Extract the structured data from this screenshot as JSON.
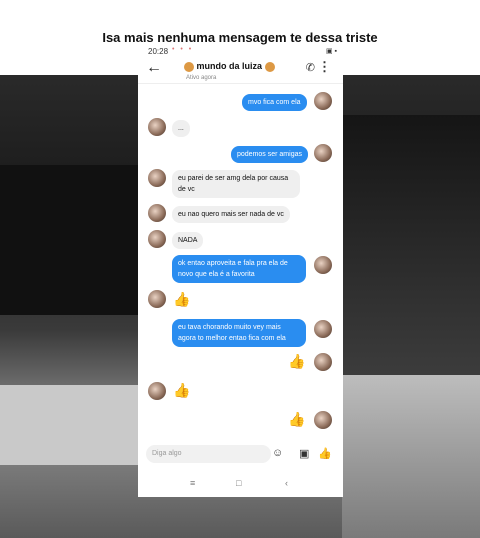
{
  "caption": "Isa mais nenhuma mensagem te dessa triste",
  "status": {
    "time": "20:28",
    "dots": "• • •",
    "icons": "▣ ▪"
  },
  "header": {
    "contact_name": "mundo da luiza",
    "subtitle": "Ativo agora"
  },
  "messages": [
    {
      "dir": "out",
      "text": "mvo fica com ela"
    },
    {
      "dir": "in",
      "text": "..."
    },
    {
      "dir": "out",
      "text": "podemos ser amigas"
    },
    {
      "dir": "in",
      "text": "eu parei de ser amg dela por causa de vc"
    },
    {
      "dir": "in",
      "text": "eu nao quero mais ser nada de vc"
    },
    {
      "dir": "in",
      "text": "NADA"
    },
    {
      "dir": "out",
      "text": "ok entao aproveita e fala pra ela de novo que ela é a favorita"
    },
    {
      "dir": "in",
      "text": "👍"
    },
    {
      "dir": "out",
      "text": "eu tava chorando muito vey mais agora to melhor entao fica com ela"
    },
    {
      "dir": "out",
      "text": "👍"
    },
    {
      "dir": "in",
      "text": "👍"
    },
    {
      "dir": "out",
      "text": "👍"
    }
  ],
  "composer": {
    "placeholder": "Diga algo"
  },
  "navbar": {
    "menu": "≡",
    "home": "□",
    "back": "‹"
  }
}
